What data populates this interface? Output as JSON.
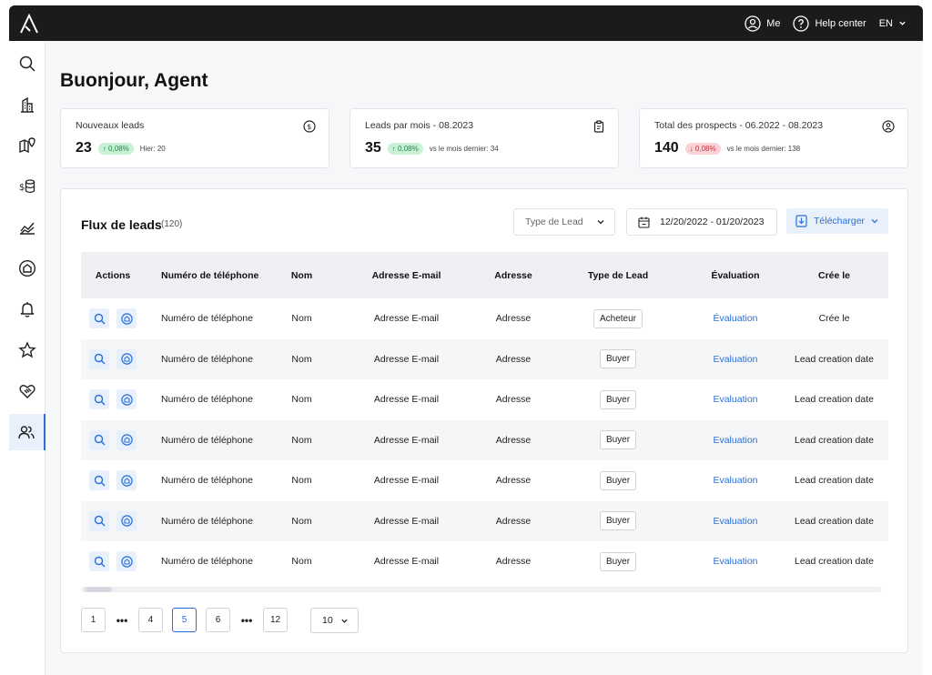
{
  "topbar": {
    "logo_icon": "a-logo-icon",
    "me_label": "Me",
    "help_label": "Help center",
    "lang_label": "EN"
  },
  "sidebar": {
    "items": [
      {
        "name": "search-icon",
        "active": false
      },
      {
        "name": "building-icon",
        "active": false
      },
      {
        "name": "map-pin-icon",
        "active": false
      },
      {
        "name": "dollar-stack-icon",
        "active": false
      },
      {
        "name": "chart-area-icon",
        "active": false
      },
      {
        "name": "home-circle-icon",
        "active": false
      },
      {
        "name": "bell-icon",
        "active": false
      },
      {
        "name": "star-icon",
        "active": false
      },
      {
        "name": "handshake-heart-icon",
        "active": false
      },
      {
        "name": "users-icon",
        "active": true
      }
    ]
  },
  "greeting": "Buonjour, Agent",
  "cards": [
    {
      "title": "Nouveaux leads",
      "value": "23",
      "delta": "↑ 0,08%",
      "trend": "up",
      "sub": "Hier: 20",
      "icon": "dollar-circle-icon"
    },
    {
      "title": "Leads par mois - 08.2023",
      "value": "35",
      "delta": "↑ 0,08%",
      "trend": "up",
      "sub": "vs le mois dernier: 34",
      "icon": "clipboard-icon"
    },
    {
      "title": "Total des prospects - 06.2022 - 08.2023",
      "value": "140",
      "delta": "↓ 0,08%",
      "trend": "down",
      "sub": "vs le mois dernier: 138",
      "icon": "user-circle-icon"
    }
  ],
  "panel": {
    "title": "Flux de leads",
    "count": "(120)",
    "type_dropdown": "Type de Lead",
    "date_range": "12/20/2022 - 01/20/2023",
    "download_label": "Télécharger"
  },
  "table": {
    "headers": [
      "Actions",
      "Numéro de téléphone",
      "Nom",
      "Adresse E-mail",
      "Adresse",
      "Type de Lead",
      "Évaluation",
      "Crée le"
    ],
    "rows": [
      {
        "phone": "Numéro de téléphone",
        "name": "Nom",
        "email": "Adresse E-mail",
        "address": "Adresse",
        "type": "Acheteur",
        "evaluation": "Évaluation",
        "created": "Crée le"
      },
      {
        "phone": "Numéro de téléphone",
        "name": "Nom",
        "email": "Adresse E-mail",
        "address": "Adresse",
        "type": "Buyer",
        "evaluation": "Evaluation",
        "created": "Lead creation date"
      },
      {
        "phone": "Numéro de téléphone",
        "name": "Nom",
        "email": "Adresse E-mail",
        "address": "Adresse",
        "type": "Buyer",
        "evaluation": "Evaluation",
        "created": "Lead creation date"
      },
      {
        "phone": "Numéro de téléphone",
        "name": "Nom",
        "email": "Adresse E-mail",
        "address": "Adresse",
        "type": "Buyer",
        "evaluation": "Evaluation",
        "created": "Lead creation date"
      },
      {
        "phone": "Numéro de téléphone",
        "name": "Nom",
        "email": "Adresse E-mail",
        "address": "Adresse",
        "type": "Buyer",
        "evaluation": "Evaluation",
        "created": "Lead creation date"
      },
      {
        "phone": "Numéro de téléphone",
        "name": "Nom",
        "email": "Adresse E-mail",
        "address": "Adresse",
        "type": "Buyer",
        "evaluation": "Evaluation",
        "created": "Lead creation date"
      },
      {
        "phone": "Numéro de téléphone",
        "name": "Nom",
        "email": "Adresse E-mail",
        "address": "Adresse",
        "type": "Buyer",
        "evaluation": "Evaluation",
        "created": "Lead creation date"
      }
    ]
  },
  "pagination": {
    "pages": [
      "1",
      "•••",
      "4",
      "5",
      "6",
      "•••",
      "12"
    ],
    "active": "5",
    "per_page": "10"
  },
  "colors": {
    "accent": "#2a6fd6",
    "topbar": "#1b1b1b",
    "up_bg": "#c9f1d5",
    "down_bg": "#fbd3d7"
  }
}
